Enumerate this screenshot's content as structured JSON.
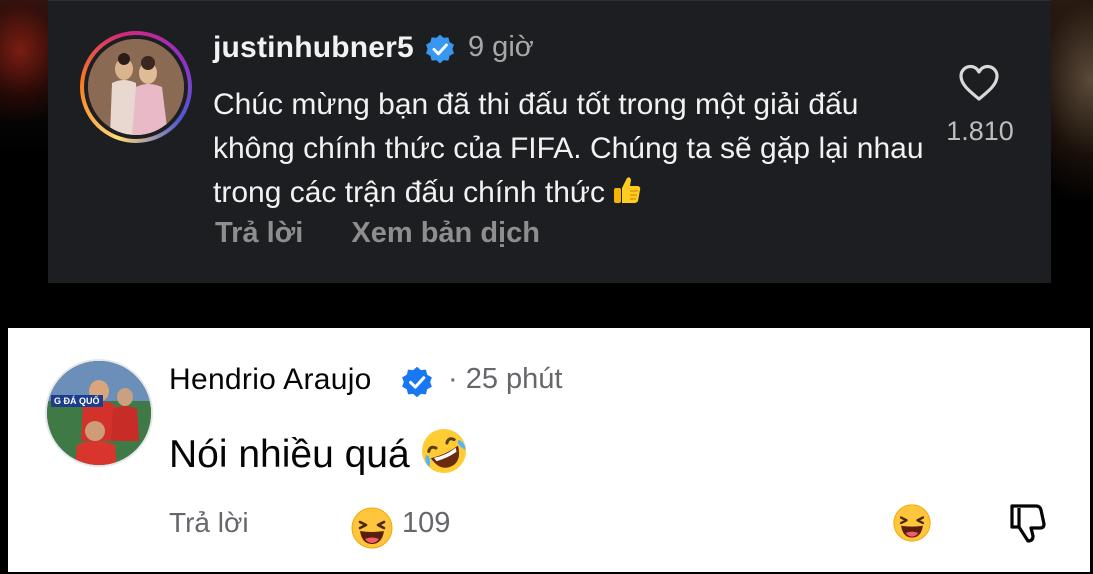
{
  "instagram_comment": {
    "username": "justinhubner5",
    "time": "9 giờ",
    "text": "Chúc mừng bạn đã thi đấu tốt trong một giải đấu không chính thức của FIFA. Chúng ta sẽ gặp lại nhau trong các trận đấu chính thức",
    "like_count": "1.810",
    "actions": {
      "reply": "Trả lời",
      "translate": "Xem bản dịch"
    },
    "icons": {
      "verified": "verified-badge-icon",
      "heart": "heart-icon",
      "thumbs_up": "thumbs-up-emoji"
    }
  },
  "facebook_comment": {
    "name": "Hendrio Araujo",
    "separator": "·",
    "time": "25 phút",
    "text": "Nói nhiều quá",
    "reply": "Trả lời",
    "reaction_count": "109",
    "avatar_badge": "G ĐÁ QUỐ",
    "icons": {
      "verified": "verified-badge-icon",
      "laughing": "rofl-emoji",
      "haha": "haha-reaction-icon",
      "dislike": "thumbs-down-icon"
    }
  },
  "colors": {
    "ig_card_bg": "#1c1e22",
    "ig_text": "#f2f2f2",
    "ig_muted": "#8e8e8e",
    "verified_blue": "#3897f0",
    "fb_verified_blue": "#1877f2",
    "fb_card_bg": "#ffffff",
    "fb_muted": "#65676b"
  }
}
